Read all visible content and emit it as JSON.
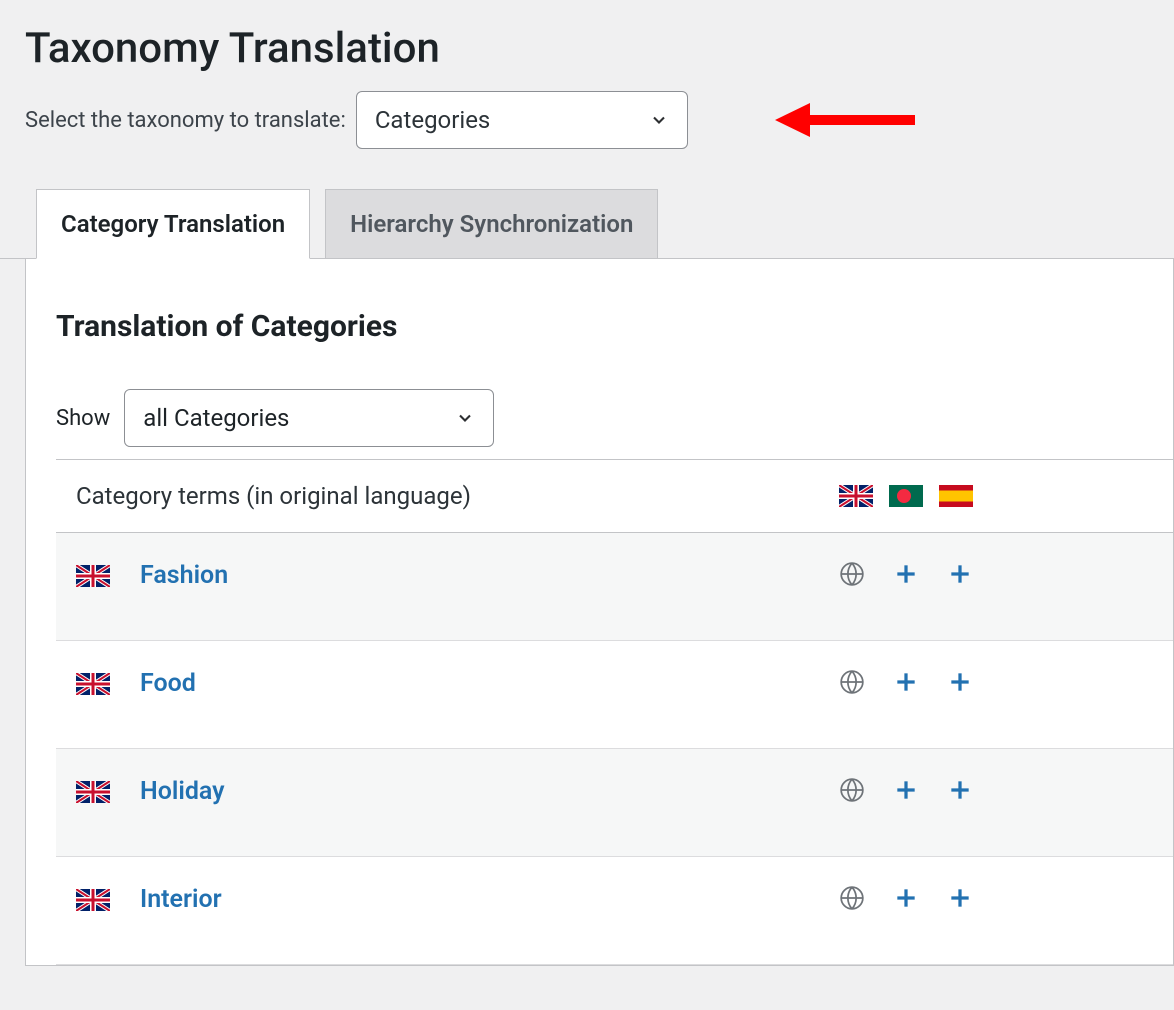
{
  "pageTitle": "Taxonomy Translation",
  "selectLabel": "Select the taxonomy to translate:",
  "selectValue": "Categories",
  "tabs": {
    "active": "Category Translation",
    "inactive": "Hierarchy Synchronization"
  },
  "panel": {
    "subtitle": "Translation of Categories",
    "showLabel": "Show",
    "showValue": "all Categories",
    "headerLeft": "Category terms (in original language)",
    "headerFlagNames": [
      "uk-flag",
      "bd-flag",
      "es-flag"
    ],
    "rows": [
      {
        "flag": "uk",
        "term": "Fashion"
      },
      {
        "flag": "uk",
        "term": "Food"
      },
      {
        "flag": "uk",
        "term": "Holiday"
      },
      {
        "flag": "uk",
        "term": "Interior"
      }
    ]
  }
}
